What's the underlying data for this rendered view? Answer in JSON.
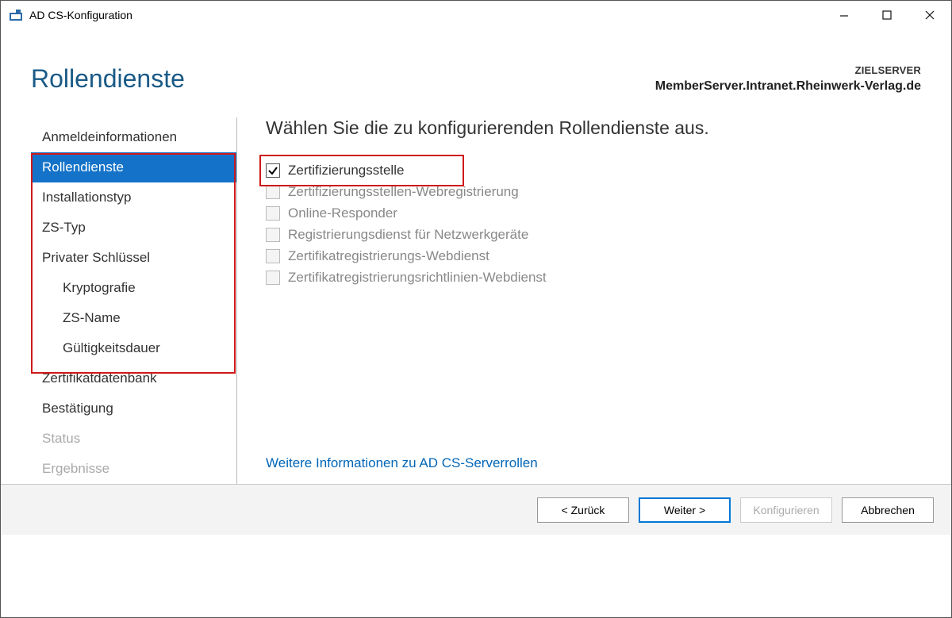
{
  "window": {
    "title": "AD CS-Konfiguration"
  },
  "header": {
    "page_title": "Rollendienste",
    "target_label": "ZIELSERVER",
    "target_name": "MemberServer.Intranet.Rheinwerk-Verlag.de"
  },
  "sidebar": {
    "items": [
      {
        "label": "Anmeldeinformationen",
        "indent": false,
        "selected": false,
        "disabled": false
      },
      {
        "label": "Rollendienste",
        "indent": false,
        "selected": true,
        "disabled": false
      },
      {
        "label": "Installationstyp",
        "indent": false,
        "selected": false,
        "disabled": false
      },
      {
        "label": "ZS-Typ",
        "indent": false,
        "selected": false,
        "disabled": false
      },
      {
        "label": "Privater Schlüssel",
        "indent": false,
        "selected": false,
        "disabled": false
      },
      {
        "label": "Kryptografie",
        "indent": true,
        "selected": false,
        "disabled": false
      },
      {
        "label": "ZS-Name",
        "indent": true,
        "selected": false,
        "disabled": false
      },
      {
        "label": "Gültigkeitsdauer",
        "indent": true,
        "selected": false,
        "disabled": false
      },
      {
        "label": "Zertifikatdatenbank",
        "indent": false,
        "selected": false,
        "disabled": false
      },
      {
        "label": "Bestätigung",
        "indent": false,
        "selected": false,
        "disabled": false
      },
      {
        "label": "Status",
        "indent": false,
        "selected": false,
        "disabled": true
      },
      {
        "label": "Ergebnisse",
        "indent": false,
        "selected": false,
        "disabled": true
      }
    ]
  },
  "content": {
    "heading": "Wählen Sie die zu konfigurierenden Rollendienste aus.",
    "options": [
      {
        "label": "Zertifizierungsstelle",
        "checked": true,
        "enabled": true
      },
      {
        "label": "Zertifizierungsstellen-Webregistrierung",
        "checked": false,
        "enabled": false
      },
      {
        "label": "Online-Responder",
        "checked": false,
        "enabled": false
      },
      {
        "label": "Registrierungsdienst für Netzwerkgeräte",
        "checked": false,
        "enabled": false
      },
      {
        "label": "Zertifikatregistrierungs-Webdienst",
        "checked": false,
        "enabled": false
      },
      {
        "label": "Zertifikatregistrierungsrichtlinien-Webdienst",
        "checked": false,
        "enabled": false
      }
    ],
    "more_link": "Weitere Informationen zu AD CS-Serverrollen"
  },
  "footer": {
    "back": "< Zurück",
    "next": "Weiter >",
    "configure": "Konfigurieren",
    "cancel": "Abbrechen"
  }
}
